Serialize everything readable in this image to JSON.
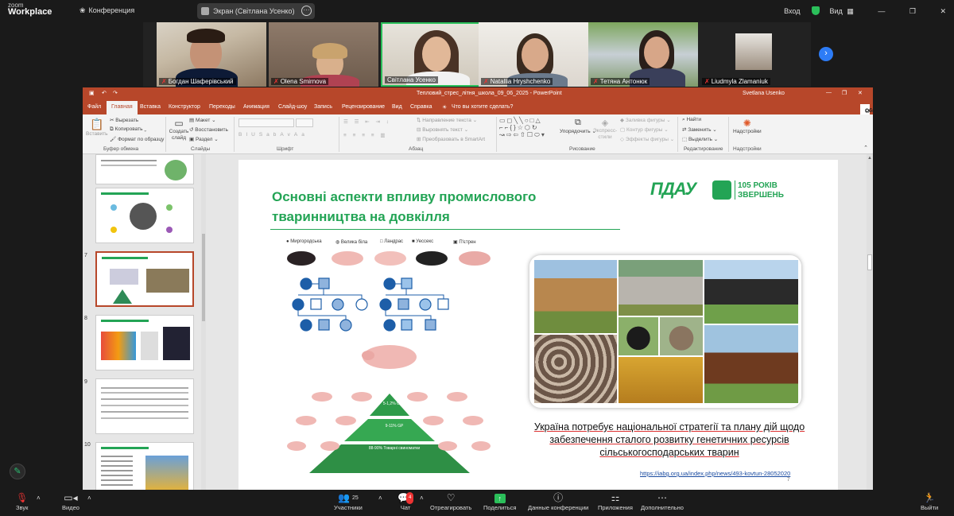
{
  "zoom": {
    "logo_top": "zoom",
    "logo_bottom": "Workplace",
    "conference_label": "Конференция",
    "screen_share_label": "Экран (Світлана Усенко)",
    "login_label": "Вход",
    "view_label": "Вид"
  },
  "participants": [
    {
      "name": "Богдан Шаферівський"
    },
    {
      "name": "Olena Smirnova"
    },
    {
      "name": "Світлана Усенко"
    },
    {
      "name": "Natallia Hryshchenko"
    },
    {
      "name": "Тетяна Антонюк"
    },
    {
      "name": "Liudmyla Zlamaniuk"
    }
  ],
  "ppt": {
    "file_title": "Тепловий_стрес_літня_школа_09_06_2025  -  PowerPoint",
    "user": "Svetlana Usenko",
    "tabs": [
      "Файл",
      "Главная",
      "Вставка",
      "Конструктор",
      "Переходы",
      "Анимация",
      "Слайд-шоу",
      "Запись",
      "Рецензирование",
      "Вид",
      "Справка"
    ],
    "tell_me": "Что вы хотите сделать?",
    "share_label": "Общий доступ",
    "ribbon": {
      "paste": "Вставить",
      "cut": "Вырезать",
      "copy": "Копировать",
      "format_painter": "Формат по образцу",
      "clipboard_group": "Буфер обмена",
      "new_slide": "Создать слайд",
      "layout": "Макет",
      "reset": "Восстановить",
      "section": "Раздел",
      "slides_group": "Слайды",
      "font_group": "Шрифт",
      "text_dir": "Направление текста",
      "align_text": "Выровнять текст",
      "smartart": "Преобразовать в SmartArt",
      "paragraph_group": "Абзац",
      "arrange": "Упорядочить",
      "quick_styles": "Экспресс-стили",
      "shape_fill": "Заливка фигуры",
      "shape_outline": "Контур фигуры",
      "shape_effects": "Эффекты фигуры",
      "drawing_group": "Рисование",
      "find": "Найти",
      "replace": "Заменить",
      "select": "Выделить",
      "editing_group": "Редактирование",
      "addins": "Надстройки",
      "addins_group": "Надстройки"
    },
    "thumb_numbers": [
      "7",
      "8",
      "9",
      "10"
    ],
    "slide": {
      "title": "Основні аспекти впливу промислового тваринництва на довкілля",
      "logo_abbr": "ПДАУ",
      "logo_years": "105 РОКІВ",
      "logo_tag": "ЗВЕРШЕНЬ",
      "breeds": [
        "Миргородська",
        "Велика біла",
        "Ландрас",
        "Уессекс",
        "П'єтрен"
      ],
      "caption": "Україна потребує національної стратегії та плану дій щодо забезпечення сталого розвитку генетичних ресурсів сільськогосподарських тварин",
      "link": "https://iabg.org.ua/index.php/news/493-kovtun-28052020",
      "page_number": "7",
      "pyramid_labels": [
        "5-1,2% GGP",
        "9-11% GP",
        "88-90% Товарні свиноматки"
      ]
    }
  },
  "toolbar": {
    "audio": "Звук",
    "video": "Видео",
    "participants": "Участники",
    "participants_count": "25",
    "chat": "Чат",
    "chat_badge": "4",
    "react": "Отреагировать",
    "share": "Поделиться",
    "meeting_data": "Данные конференции",
    "apps": "Приложения",
    "more": "Дополнительно",
    "leave": "Выйти"
  }
}
